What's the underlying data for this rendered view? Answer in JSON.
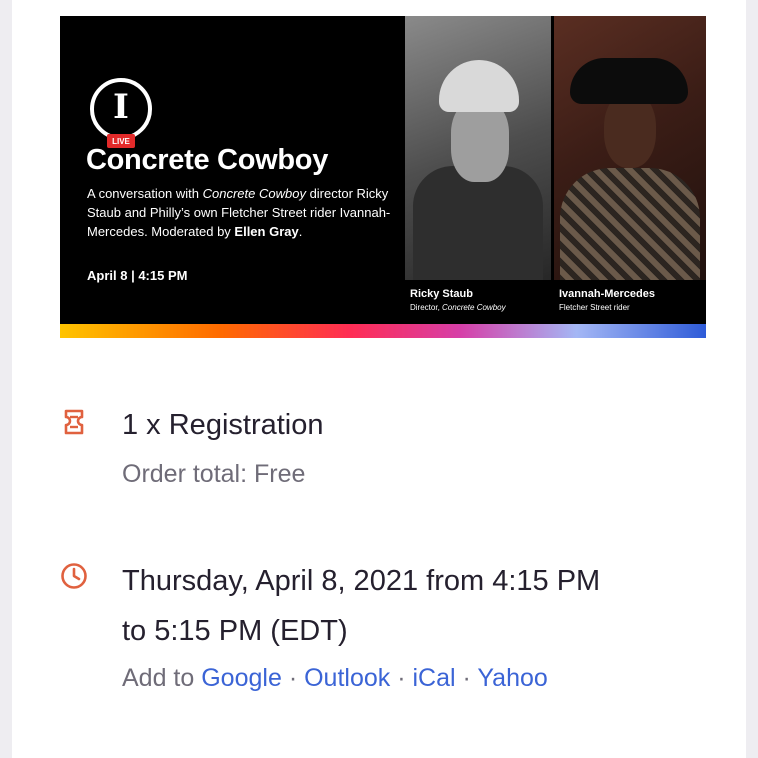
{
  "banner": {
    "logo_letter": "I",
    "logo_badge": "LIVE",
    "title": "Concrete Cowboy",
    "description_1": "A conversation with ",
    "description_film": "Concrete Cowboy",
    "description_2": " director Ricky Staub and Philly’s own Fletcher Street rider Ivannah-Mercedes. Moderated by ",
    "description_moderator": "Ellen Gray",
    "description_3": ".",
    "date": "April 8 | 4:15 PM",
    "people": [
      {
        "name": "Ricky Staub",
        "role_prefix": "Director, ",
        "role_film": "Concrete Cowboy"
      },
      {
        "name": "Ivannah-Mercedes",
        "role_prefix": "Fletcher Street rider",
        "role_film": ""
      }
    ]
  },
  "registration": {
    "icon": "ticket-icon",
    "title": "1 x Registration",
    "order_total": "Order total: Free"
  },
  "schedule": {
    "icon": "clock-icon",
    "line_1": "Thursday, April 8, 2021 from 4:15 PM",
    "line_2": "to 5:15 PM (EDT)",
    "add_to_label": "Add to",
    "calendars": [
      "Google",
      "Outlook",
      "iCal",
      "Yahoo"
    ],
    "separator": "·"
  },
  "colors": {
    "accent_icon": "#e0613f",
    "link": "#3b64d6",
    "text_primary": "#25202e",
    "text_secondary": "#6f6c78"
  }
}
